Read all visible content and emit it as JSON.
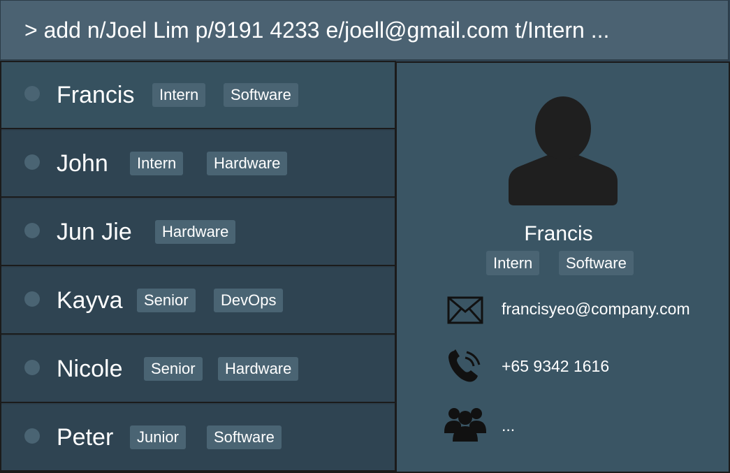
{
  "command": {
    "text": "> add n/Joel Lim p/9191 4233 e/joell@gmail.com t/Intern ..."
  },
  "people": [
    {
      "name": "Francis",
      "tags": [
        "Intern",
        "Software"
      ]
    },
    {
      "name": "John",
      "tags": [
        "Intern",
        "Hardware"
      ]
    },
    {
      "name": "Jun Jie",
      "tags": [
        "Hardware"
      ]
    },
    {
      "name": "Kayva",
      "tags": [
        "Senior",
        "DevOps"
      ]
    },
    {
      "name": "Nicole",
      "tags": [
        "Senior",
        "Hardware"
      ]
    },
    {
      "name": "Peter",
      "tags": [
        "Junior",
        "Software"
      ]
    }
  ],
  "detail": {
    "name": "Francis",
    "tags": [
      "Intern",
      "Software"
    ],
    "email": "francisyeo@company.com",
    "phone": "+65 9342 1616",
    "group": "..."
  },
  "icons": {
    "avatar": "person-silhouette-icon",
    "email": "envelope-icon",
    "phone": "phone-icon",
    "group": "people-group-icon"
  },
  "colors": {
    "command_bg": "#4b6272",
    "list_row_bg": "#2f4452",
    "selected_row_bg": "#36515f",
    "detail_bg": "#3a5564",
    "tag_bg": "#4a6473"
  }
}
